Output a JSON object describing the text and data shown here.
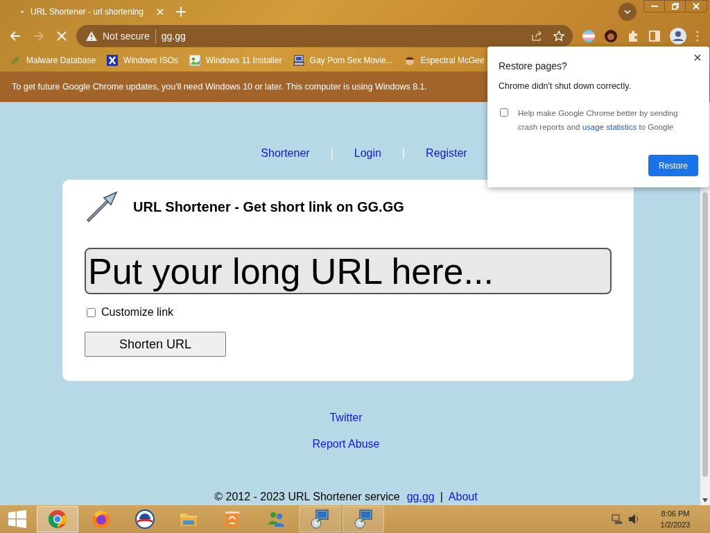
{
  "tab": {
    "title": "URL Shortener - url shortening",
    "loading": true
  },
  "address_bar": {
    "security": "Not secure",
    "url": "gg.gg"
  },
  "bookmarks": [
    {
      "label": "Malware Database",
      "kind": "leaf"
    },
    {
      "label": "Windows ISOs",
      "kind": "x"
    },
    {
      "label": "Windows 11 Installer",
      "kind": "image"
    },
    {
      "label": "Gay Porn Sex Movie...",
      "kind": "computer"
    },
    {
      "label": "Espectral McGee",
      "kind": "face"
    }
  ],
  "infobar": {
    "message": "To get future Google Chrome updates, you'll need Windows 10 or later. This computer is using Windows 8.1."
  },
  "nav": [
    {
      "kind": "link",
      "text": "Shortener"
    },
    {
      "kind": "separator",
      "text": "|"
    },
    {
      "kind": "link",
      "text": "Login"
    },
    {
      "kind": "separator",
      "text": "|"
    },
    {
      "kind": "link",
      "text": "Register"
    }
  ],
  "card": {
    "title": "URL Shortener - Get short link on GG.GG",
    "url_field": {
      "placeholder": "Put your long URL here..."
    },
    "customize": {
      "label": "Customize link",
      "checked": false
    },
    "button": "Shorten URL"
  },
  "links": [
    "Twitter",
    "Report Abuse"
  ],
  "footer": {
    "copyright": "© 2012 - 2023 URL Shortener service",
    "site_link": "gg.gg",
    "separator": "|",
    "about": "About"
  },
  "restore_popup": {
    "title": "Restore pages?",
    "message": "Chrome didn't shut down correctly.",
    "consent": {
      "text_before": "Help make Google Chrome better by sending crash reports and",
      "link": "usage statistics",
      "text_after": "to Google",
      "checked": false
    },
    "button": "Restore"
  },
  "taskbar": [
    {
      "kind": "chrome",
      "selected": true
    },
    {
      "kind": "firefox",
      "selected": false
    },
    {
      "kind": "obama",
      "selected": false
    },
    {
      "kind": "explorer",
      "selected": false
    },
    {
      "kind": "recycle",
      "selected": false
    },
    {
      "kind": "messenger",
      "selected": false
    },
    {
      "kind": "installer",
      "selected": false
    },
    {
      "kind": "installer",
      "selected": false
    }
  ],
  "clock": {
    "time": "8:06 PM",
    "date": "1/2/2023"
  }
}
